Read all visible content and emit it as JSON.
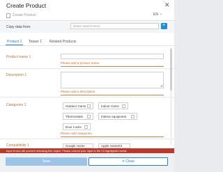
{
  "dialog": {
    "title": "Create Product",
    "subtitle": "Create Product",
    "language": "EN",
    "close_glyph": "✕",
    "lang_chevron": "⌄"
  },
  "copy_data": {
    "label": "Copy data from:",
    "placeholder": "(Enter search term)",
    "button_glyph": "+"
  },
  "tabs": [
    {
      "label": "Product 1",
      "active": true
    },
    {
      "label": "Teaser 1",
      "active": false
    },
    {
      "label": "Related Products",
      "active": false
    }
  ],
  "fields": {
    "product_name": {
      "label": "Product name 1",
      "error": "Please add a product name."
    },
    "description": {
      "label": "Description 1",
      "error": "Please add a description."
    },
    "categories": {
      "label": "Categories 1",
      "options": [
        "Outdoor Cams",
        "Indoor Cams",
        "Thermostats",
        "Interior equipment",
        "Door Locks"
      ],
      "error": "Please add categories."
    },
    "compatibility": {
      "label": "Compatibility 1",
      "options": [
        "Google Home",
        "Apple HomeKit"
      ]
    }
  },
  "banner": "Input errors will prevent releasing this object. Please correct your input in the 10 highlighted areas",
  "footer": {
    "save_label": "Save",
    "close_label": "Close",
    "close_glyph": "✕"
  },
  "colors": {
    "accent": "#2a7fc8",
    "error": "#c8702c",
    "banner": "#b93a2b"
  }
}
